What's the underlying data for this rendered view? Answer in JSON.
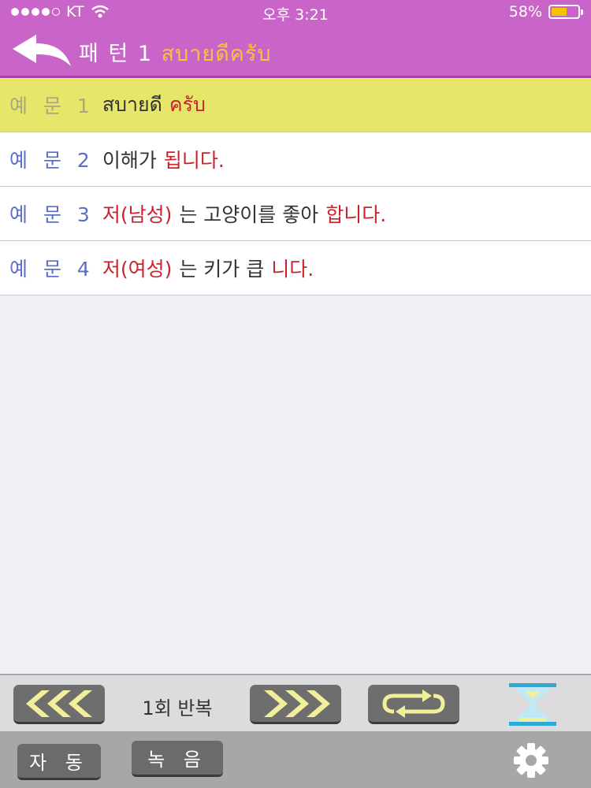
{
  "status": {
    "carrier": "KT",
    "time": "오후 3:21",
    "battery_text": "58%",
    "battery_level": 0.58,
    "signal_bars": 4,
    "signal_total": 5
  },
  "nav": {
    "title_prefix": "패 턴 1",
    "title_thai": "สบายดีครับ",
    "back_icon": "back-arrow-icon"
  },
  "colors": {
    "header": "#c964c9",
    "title_accent": "#f7c23e",
    "active_row": "#e6e66b",
    "label_blue": "#5b6fc9",
    "highlight_red": "#c9242e"
  },
  "examples": [
    {
      "label": "예 문 1",
      "segments": [
        {
          "text": "สบายดี",
          "color": "black"
        },
        {
          "text": "ครับ",
          "color": "red"
        }
      ],
      "active": true
    },
    {
      "label": "예 문 2",
      "segments": [
        {
          "text": "이해가",
          "color": "black"
        },
        {
          "text": "됩니다.",
          "color": "red"
        }
      ],
      "active": false
    },
    {
      "label": "예 문 3",
      "segments": [
        {
          "text": "저(남성)",
          "color": "red"
        },
        {
          "text": "는 고양이를 좋아",
          "color": "black"
        },
        {
          "text": "합니다.",
          "color": "red"
        }
      ],
      "active": false
    },
    {
      "label": "예 문 4",
      "segments": [
        {
          "text": "저(여성)",
          "color": "red"
        },
        {
          "text": "는 키가 큽",
          "color": "black"
        },
        {
          "text": "니다.",
          "color": "red"
        }
      ],
      "active": false
    }
  ],
  "toolbar": {
    "prev_icon": "rewind-icon",
    "repeat_label": "1회 반복",
    "next_icon": "fast-forward-icon",
    "loop_icon": "repeat-icon",
    "timer_icon": "hourglass-icon"
  },
  "bottom": {
    "auto_label": "자 동",
    "record_label": "녹 음",
    "settings_icon": "gear-icon"
  }
}
